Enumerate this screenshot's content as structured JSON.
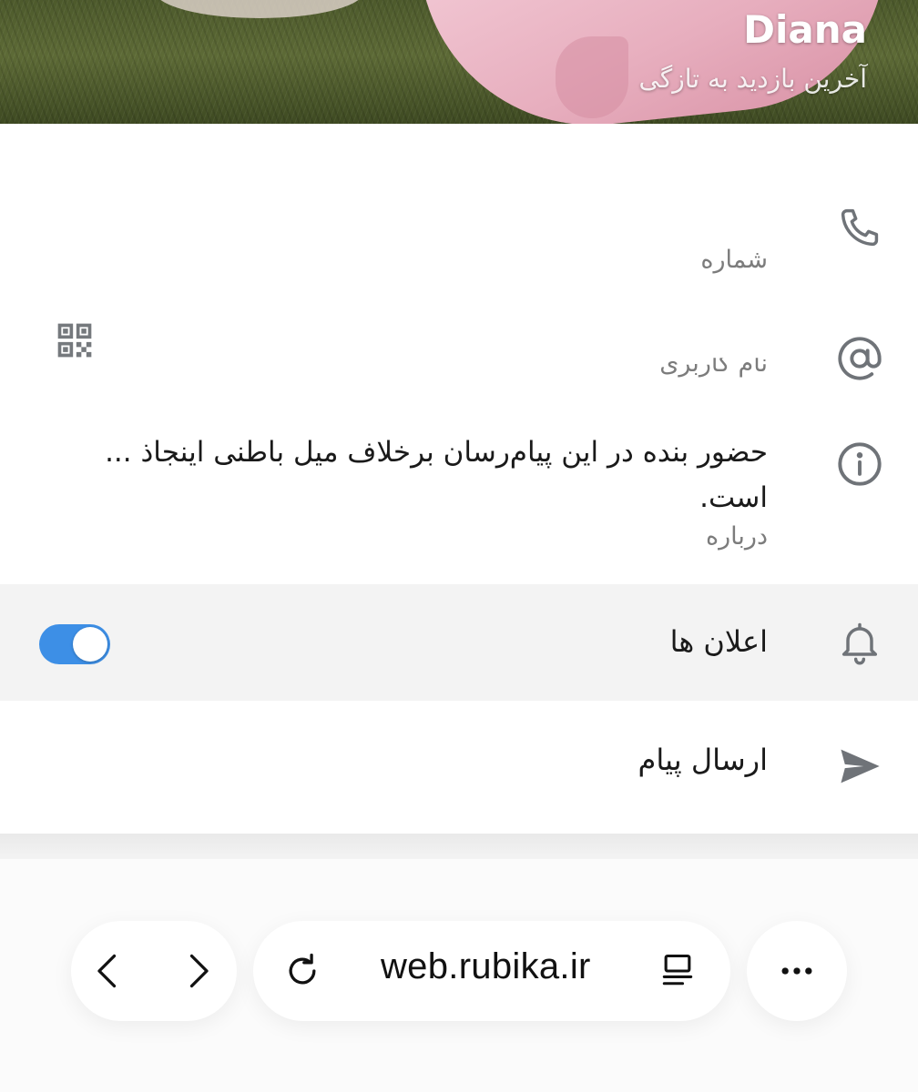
{
  "profile": {
    "name": "Diana",
    "last_seen": "آخرین بازدید به تازگی"
  },
  "info": {
    "phone": {
      "icon": "phone-icon",
      "caption": "شماره"
    },
    "username": {
      "icon": "at-sign-icon",
      "caption": "نام کاربری",
      "qr_icon": "qr-code-icon"
    },
    "about": {
      "icon": "info-icon",
      "text": "حضور بنده در این پیام‌رسان برخلاف میل باطنی اینجاذ ... است.",
      "caption": "درباره"
    },
    "notifications": {
      "icon": "bell-icon",
      "label": "اعلان ها",
      "enabled": true,
      "accent": "#3d8fe6"
    },
    "send_message": {
      "icon": "send-icon",
      "label": "ارسال پیام"
    }
  },
  "browser": {
    "url": "web.rubika.ir",
    "back_icon": "chevron-left-icon",
    "forward_icon": "chevron-right-icon",
    "reload_icon": "reload-icon",
    "reader_icon": "reader-mode-icon",
    "more_icon": "more-icon"
  }
}
